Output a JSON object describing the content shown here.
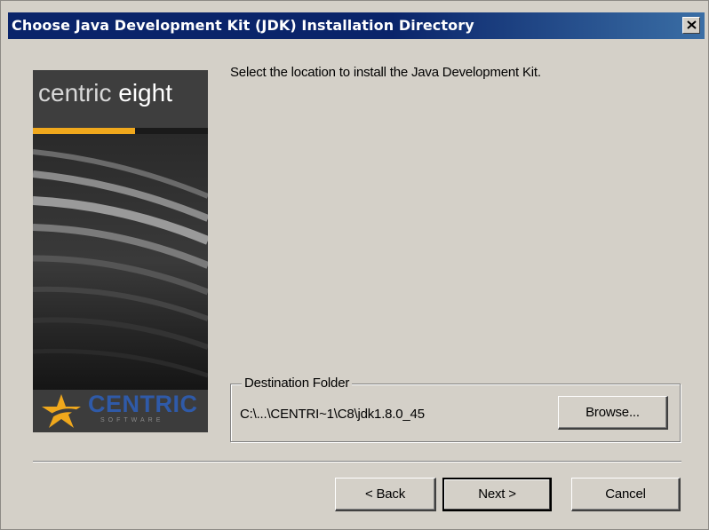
{
  "window": {
    "title": "Choose Java Development Kit (JDK) Installation Directory",
    "close_label": "×"
  },
  "branding": {
    "product_word1": "centric",
    "product_word2": "eight",
    "company": "CENTRIC",
    "company_sub": "SOFTWARE",
    "accent_color": "#f0a81c",
    "brand_blue": "#2f5aa8"
  },
  "content": {
    "instruction": "Select the location to install the Java Development Kit.",
    "destination_group_label": "Destination Folder",
    "destination_path": "C:\\...\\CENTRI~1\\C8\\jdk1.8.0_45"
  },
  "buttons": {
    "browse": "Browse...",
    "back": "< Back",
    "next": "Next >",
    "cancel": "Cancel"
  }
}
